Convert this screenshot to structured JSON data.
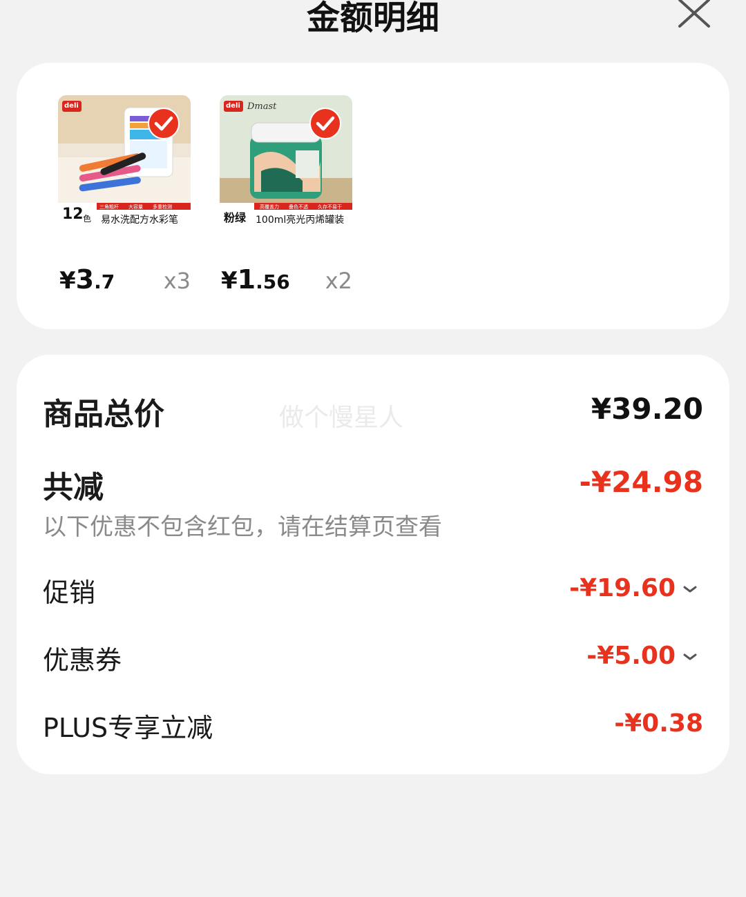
{
  "header": {
    "title": "金额明细",
    "close_icon": "close-icon"
  },
  "products": [
    {
      "corner_text": "deli",
      "badge_number": "12",
      "badge_unit": "色",
      "tags": [
        "三角粗杆",
        "大容量",
        "多重检测"
      ],
      "name": "易水洗配方水彩笔",
      "check_icon": "check-icon",
      "price_currency": "¥",
      "price_int": "3",
      "price_dec": ".7",
      "qty": "x3"
    },
    {
      "corner_text": "deli",
      "brand_text": "Dmast",
      "badge_number": "粉绿",
      "tags": [
        "高覆盖力",
        "叠色不透",
        "久存不易干"
      ],
      "name": "100ml亮光丙烯罐装",
      "check_icon": "check-icon",
      "price_currency": "¥",
      "price_int": "1",
      "price_dec": ".56",
      "qty": "x2"
    }
  ],
  "summary": {
    "total_label": "商品总价",
    "total_value": "¥39.20",
    "watermark": "做个慢星人",
    "reduce_label": "共减",
    "reduce_value": "-¥24.98",
    "note": "以下优惠不包含红包，请在结算页查看",
    "rows": [
      {
        "label": "促销",
        "value": "-¥19.60",
        "chevron_icon": "chevron-down-icon"
      },
      {
        "label": "优惠券",
        "value": "-¥5.00",
        "chevron_icon": "chevron-down-icon"
      },
      {
        "label": "PLUS专享立减",
        "value": "-¥0.38"
      }
    ]
  },
  "colors": {
    "accent_red": "#e8321e",
    "background": "#f2f2f2",
    "card": "#ffffff"
  }
}
